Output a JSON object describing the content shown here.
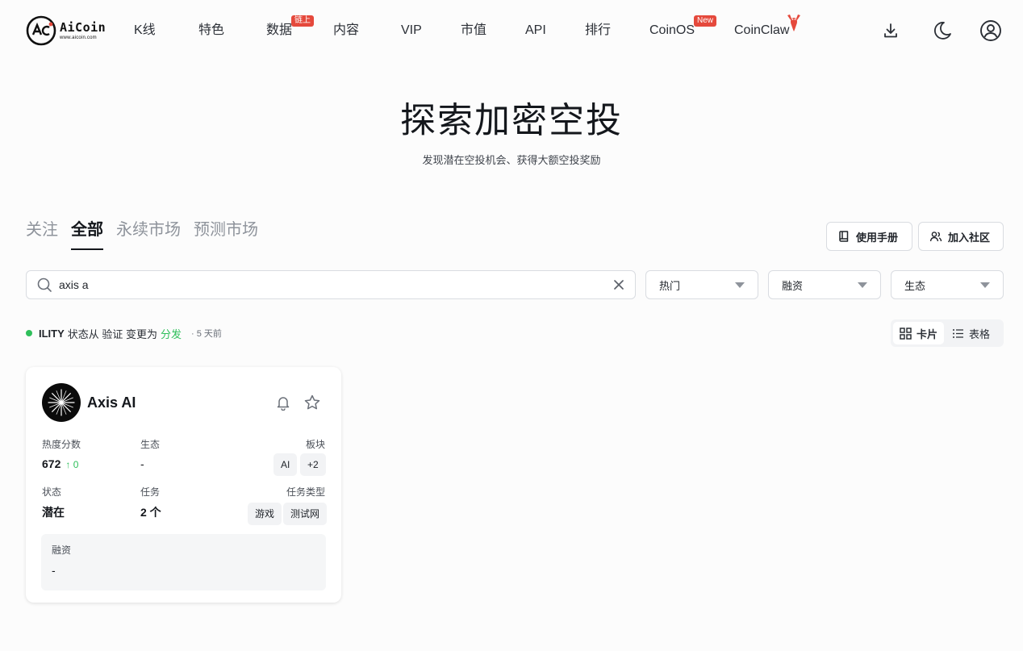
{
  "header": {
    "logo": {
      "word": "AiCoin",
      "url": "www.aicoin.com"
    },
    "nav": [
      {
        "label": "K线"
      },
      {
        "label": "特色"
      },
      {
        "label": "数据",
        "badge": "链上"
      },
      {
        "label": "内容"
      },
      {
        "label": "VIP"
      },
      {
        "label": "市值"
      },
      {
        "label": "API"
      },
      {
        "label": "排行"
      },
      {
        "label": "CoinOS",
        "badge": "New"
      },
      {
        "label": "CoinClaw"
      }
    ],
    "icons": [
      "download-icon",
      "moon-icon",
      "user-icon"
    ]
  },
  "hero": {
    "title": "探索加密空投",
    "subtitle": "发现潜在空投机会、获得大额空投奖励"
  },
  "tabs": [
    {
      "label": "关注",
      "active": false
    },
    {
      "label": "全部",
      "active": true
    },
    {
      "label": "永续市场",
      "active": false
    },
    {
      "label": "预测市场",
      "active": false
    }
  ],
  "actions": {
    "manual": "使用手册",
    "community": "加入社区"
  },
  "filters": {
    "search_value": "axis a",
    "hot": "热门",
    "funding": "融资",
    "ecosystem": "生态"
  },
  "ticker": {
    "name": "ILITY",
    "text": "状态从 验证 变更为",
    "status": "分发",
    "time": "· 5 天前"
  },
  "view_toggle": {
    "card": "卡片",
    "table": "表格",
    "active": "card"
  },
  "card": {
    "name": "Axis AI",
    "heat_label": "热度分数",
    "heat_value": "672",
    "heat_change": "↑ 0",
    "eco_label": "生态",
    "eco_value": "-",
    "sector_label": "板块",
    "sector_tags": [
      "AI",
      "+2"
    ],
    "status_label": "状态",
    "status_value": "潜在",
    "task_label": "任务",
    "task_value": "2 个",
    "task_type_label": "任务类型",
    "task_types": [
      "游戏",
      "测试网"
    ],
    "funding_label": "融资",
    "funding_value": "-"
  },
  "colors": {
    "accent_green": "#2fbf5b",
    "badge_red": "#e5493c",
    "text_dark": "#14171c",
    "muted": "#8e939b"
  }
}
